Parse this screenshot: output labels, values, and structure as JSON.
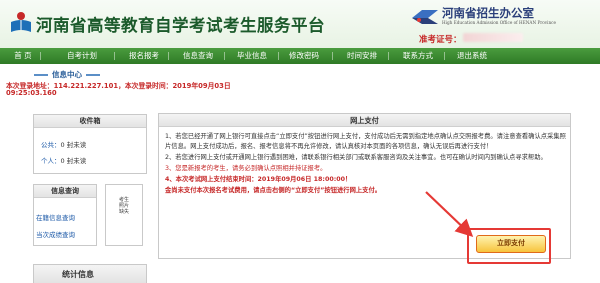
{
  "header": {
    "site_title": "河南省高等教育自学考试考生服务平台",
    "org_name": "河南省招生办公室",
    "org_en": "High Education Admission Office of HENAN Province",
    "ticket_label": "准考证号："
  },
  "nav": {
    "items": [
      "首 页",
      "自考计划",
      "报名报考",
      "信息查询",
      "毕业信息",
      "修改密码",
      "时间安排",
      "联系方式",
      "退出系统"
    ]
  },
  "info_center": {
    "heading": "信息中心",
    "login_line": "本次登录地址：114.221.227.101，本次登录时间：2019年09月03日",
    "login_time2": "09:25:03.160"
  },
  "inbox": {
    "title": "收件箱",
    "public_label": "公共：",
    "public_value": "0 封未读",
    "personal_label": "个人：",
    "personal_value": "0 封未读"
  },
  "query": {
    "title": "信息查询",
    "links": [
      "在籍信息查询",
      "当次成绩查询"
    ],
    "photo_text": "考生照片缺失"
  },
  "partial_panel": {
    "title": "统计信息"
  },
  "payment": {
    "title": "网上支付",
    "paragraphs": [
      "1、若您已经开通了网上银行可直接点击“立即支付”按钮进行网上支付，支付成功后无需到指定地点确认点交照报考费。请注意查看确认点采集照片信息。网上支付成功后，报名、报考信息将不再允许修改，请认真核对本页面的各项信息，确认无误后再进行支付！",
      "2、若您进行网上支付或开通网上银行遇到困难，请联系银行相关部门或联系客服咨询及关注事宜。也可在确认时间内到确认点寻求帮助。",
      "3、您是新报考的考生，请务必到确认点照相并持证报考。",
      "4、本次考试网上支付结束时间：2019年09月06日 18:00:00！",
      "金尚未支付本次报名考试费用，请点击右侧的“立即支付”按钮进行网上支付。"
    ],
    "pay_button": "立即支付"
  },
  "colors": {
    "nav_green": "#2f7a26",
    "title_green": "#1b5a2b",
    "alert_red": "#c62828",
    "link_blue": "#1d5aa8",
    "highlight_red": "#e53935"
  }
}
